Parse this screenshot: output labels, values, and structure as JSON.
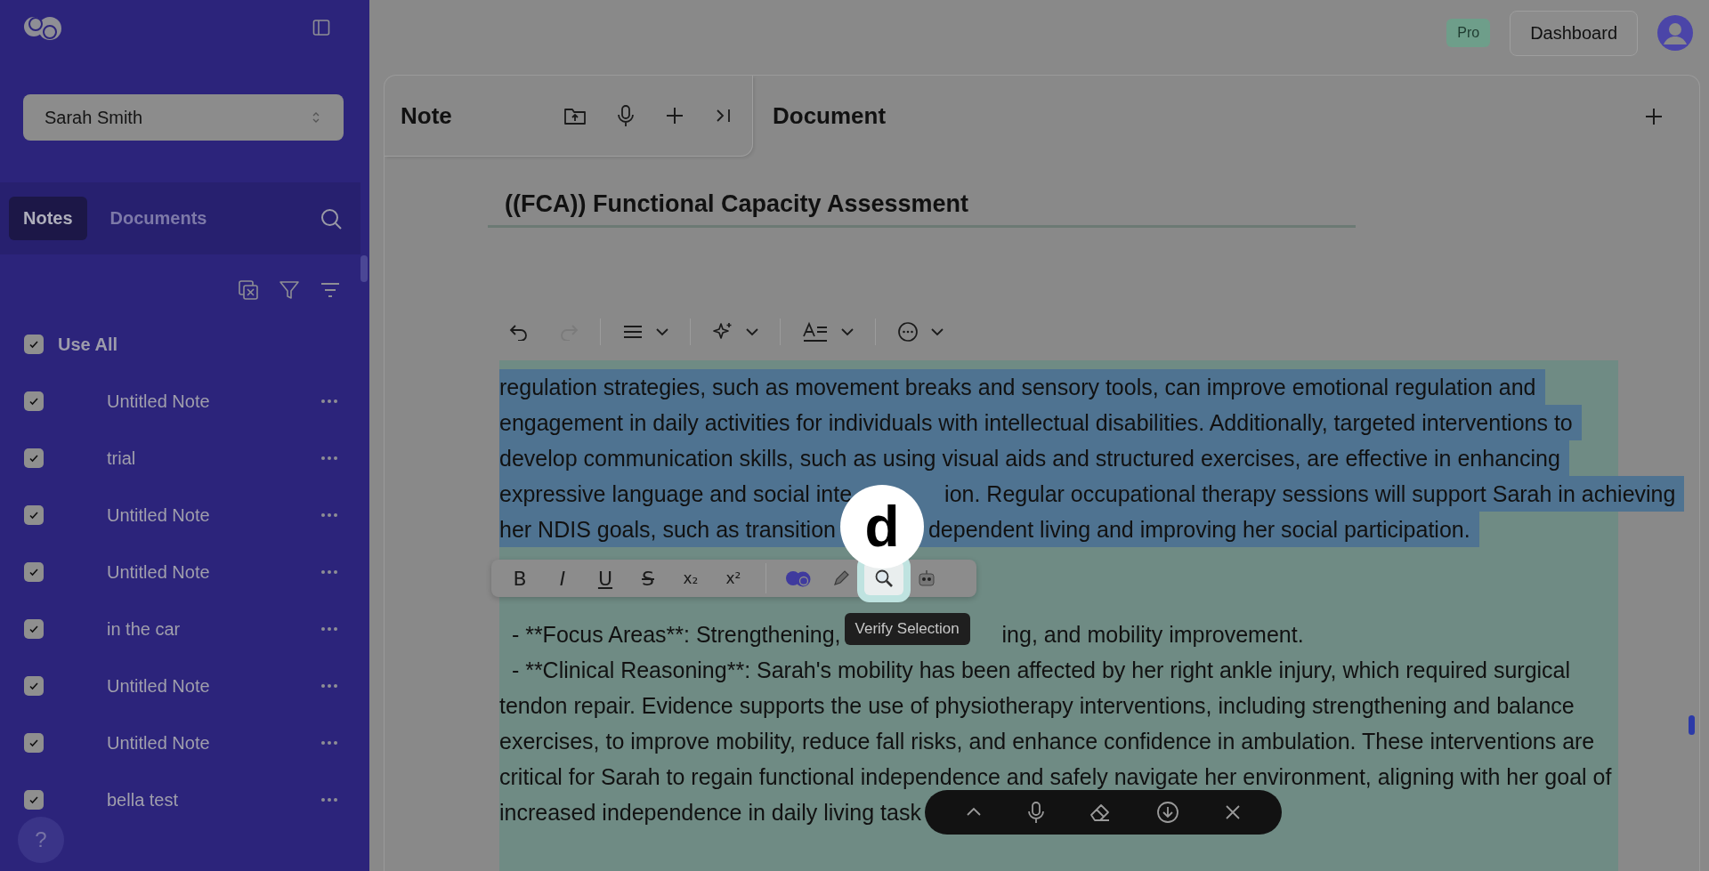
{
  "sidebar": {
    "client_select": {
      "value": "Sarah Smith"
    },
    "tabs": [
      {
        "label": "Notes",
        "selected": true
      },
      {
        "label": "Documents",
        "selected": false
      }
    ],
    "use_all": {
      "label": "Use All",
      "checked": true
    },
    "notes": [
      {
        "title": "Untitled Note",
        "checked": true
      },
      {
        "title": "trial",
        "checked": true
      },
      {
        "title": "Untitled Note",
        "checked": true
      },
      {
        "title": "Untitled Note",
        "checked": true
      },
      {
        "title": "in the car",
        "checked": true
      },
      {
        "title": "Untitled Note",
        "checked": true
      },
      {
        "title": "Untitled Note",
        "checked": true
      },
      {
        "title": "bella test",
        "checked": true
      }
    ],
    "help": "?"
  },
  "header": {
    "plan_badge": "Pro",
    "dashboard_button": "Dashboard"
  },
  "note_panel": {
    "title": "Note"
  },
  "document_panel": {
    "title": "Document",
    "heading": "((FCA)) Functional Capacity Assessment",
    "lines": [
      {
        "parts": [
          "regulation strategies, such as movement breaks and sensory tools, can improve emotional regulation and"
        ],
        "selected": true
      },
      {
        "parts": [
          "engagement in daily activities for individuals with intellectual disabilities. Additionally, targeted interventions to"
        ],
        "selected": true
      },
      {
        "parts": [
          "develop communication skills, such as using visual aids and structured exercises, are effective in enhancing"
        ],
        "selected": true
      },
      {
        "parts": [
          "expressive language and social inte",
          "ion. Regular occupational therapy sessions will support Sarah in achieving"
        ],
        "selected": true
      },
      {
        "parts": [
          "her NDIS goals, such as transition",
          "dependent living and improving her social participation."
        ],
        "selected": true
      },
      {
        "parts": [
          "  - **Focus Areas**: Strengthening,",
          "ing, and mobility improvement."
        ],
        "selected": false
      },
      {
        "parts": [
          "  - **Clinical Reasoning**: Sarah's mobility has been affected by her right ankle injury, which required surgical"
        ],
        "selected": false
      },
      {
        "parts": [
          "tendon repair. Evidence supports the use of physiotherapy interventions, including strengthening and balance"
        ],
        "selected": false
      },
      {
        "parts": [
          "exercises, to improve mobility, reduce fall risks, and enhance confidence in ambulation. These interventions are"
        ],
        "selected": false
      },
      {
        "parts": [
          "critical for Sarah to regain functional independence and safely navigate her environment, aligning with her goal of"
        ],
        "selected": false
      },
      {
        "parts": [
          "increased independence in daily living task"
        ],
        "selected": false
      }
    ],
    "format_toolbar": {
      "text_buttons": [
        {
          "label": "B",
          "kind": "bold"
        },
        {
          "label": "I",
          "kind": "italic"
        },
        {
          "label": "U",
          "kind": "underline"
        },
        {
          "label": "S",
          "kind": "strike"
        },
        {
          "label": "x₂",
          "kind": "sub"
        },
        {
          "label": "x²",
          "kind": "sup"
        }
      ],
      "tools": [
        {
          "kind": "logo",
          "highlighted": false
        },
        {
          "kind": "pencil",
          "highlighted": false
        },
        {
          "kind": "search",
          "highlighted": true
        },
        {
          "kind": "robot",
          "highlighted": false
        }
      ]
    },
    "tooltip": "Verify Selection",
    "step_marker": "d"
  }
}
